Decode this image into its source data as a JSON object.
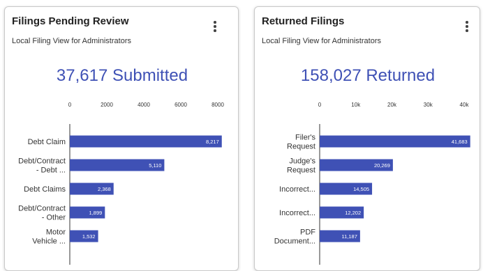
{
  "colors": {
    "bar": "#3f51b5",
    "stat_text": "#3f51b5",
    "bar_label": "#ffffff"
  },
  "cards": [
    {
      "title": "Filings Pending Review",
      "subtitle": "Local Filing View for Administrators",
      "stat": "37,617 Submitted",
      "menu_icon": "more-vert-icon"
    },
    {
      "title": "Returned Filings",
      "subtitle": "Local Filing View for Administrators",
      "stat": "158,027 Returned",
      "menu_icon": "more-vert-icon"
    }
  ],
  "chart_data": [
    {
      "type": "bar",
      "orientation": "horizontal",
      "categories": [
        [
          "Debt Claim"
        ],
        [
          "Debt/Contract",
          "- Debt ..."
        ],
        [
          "Debt Claims"
        ],
        [
          "Debt/Contract",
          "- Other"
        ],
        [
          "Motor",
          "Vehicle ..."
        ]
      ],
      "values": [
        8217,
        5110,
        2368,
        1899,
        1532
      ],
      "value_labels": [
        "8,217",
        "5,110",
        "2,368",
        "1,899",
        "1,532"
      ],
      "ticks": [
        0,
        2000,
        4000,
        6000,
        8000
      ],
      "tick_labels": [
        "0",
        "2000",
        "4000",
        "6000",
        "8000"
      ],
      "xlim": [
        0,
        8500
      ]
    },
    {
      "type": "bar",
      "orientation": "horizontal",
      "categories": [
        [
          "Filer's",
          "Request"
        ],
        [
          "Judge's",
          "Request"
        ],
        [
          "Incorrect..."
        ],
        [
          "Incorrect..."
        ],
        [
          "PDF",
          "Document..."
        ]
      ],
      "values": [
        41683,
        20269,
        14505,
        12202,
        11187
      ],
      "value_labels": [
        "41,683",
        "20,269",
        "14,505",
        "12,202",
        "11,187"
      ],
      "ticks": [
        0,
        10000,
        20000,
        30000,
        40000
      ],
      "tick_labels": [
        "0",
        "10k",
        "20k",
        "30k",
        "40k"
      ],
      "xlim": [
        0,
        42500
      ]
    }
  ]
}
